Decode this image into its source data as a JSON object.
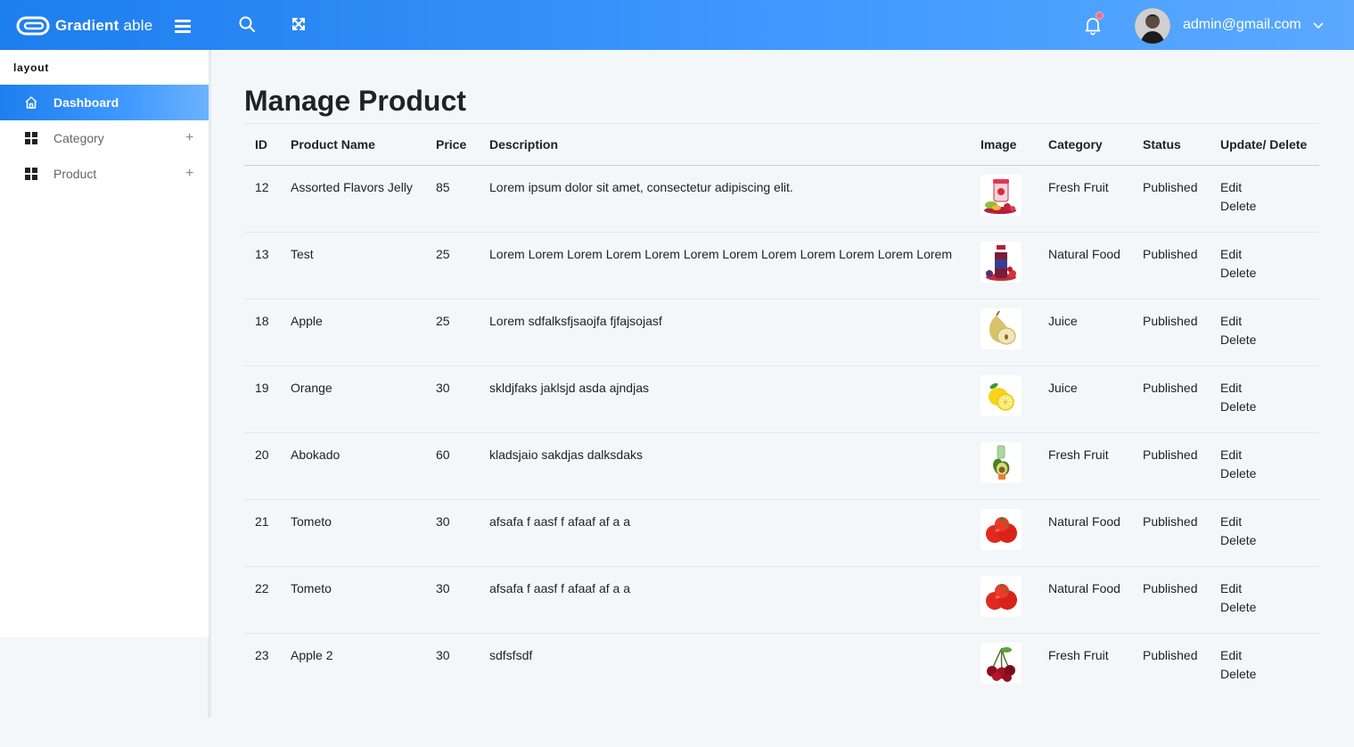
{
  "header": {
    "brand_bold": "Gradient",
    "brand_thin": "able",
    "user_email": "admin@gmail.com",
    "accent": "#4099ff"
  },
  "sidebar": {
    "caption": "layout",
    "items": [
      {
        "label": "Dashboard",
        "icon": "home-icon",
        "active": true
      },
      {
        "label": "Category",
        "icon": "grid-icon",
        "expand": "+"
      },
      {
        "label": "Product",
        "icon": "grid-icon",
        "expand": "+"
      }
    ]
  },
  "main": {
    "title": "Manage Product",
    "columns": [
      "ID",
      "Product Name",
      "Price",
      "Description",
      "Image",
      "Category",
      "Status",
      "Update/ Delete"
    ],
    "edit_label": "Edit",
    "delete_label": "Delete",
    "rows": [
      {
        "id": "12",
        "name": "Assorted Flavors Jelly",
        "price": "85",
        "description": "Lorem ipsum dolor sit amet, consectetur adipiscing elit.",
        "image": "jelly-jar",
        "category": "Fresh Fruit",
        "status": "Published"
      },
      {
        "id": "13",
        "name": "Test",
        "price": "25",
        "description": "Lorem Lorem Lorem Lorem Lorem Lorem Lorem Lorem Lorem Lorem Lorem Lorem",
        "image": "juice-bottle",
        "category": "Natural Food",
        "status": "Published"
      },
      {
        "id": "18",
        "name": "Apple",
        "price": "25",
        "description": "Lorem sdfalksfjsaojfa fjfajsojasf",
        "image": "pear",
        "category": "Juice",
        "status": "Published"
      },
      {
        "id": "19",
        "name": "Orange",
        "price": "30",
        "description": "skldjfaks jaklsjd asda ajndjas",
        "image": "lemon",
        "category": "Juice",
        "status": "Published"
      },
      {
        "id": "20",
        "name": "Abokado",
        "price": "60",
        "description": "kladsjaio sakdjas dalksdaks",
        "image": "avocado",
        "category": "Fresh Fruit",
        "status": "Published"
      },
      {
        "id": "21",
        "name": "Tometo",
        "price": "30",
        "description": "afsafa f aasf f afaaf af a a",
        "image": "tomatoes",
        "category": "Natural Food",
        "status": "Published"
      },
      {
        "id": "22",
        "name": "Tometo",
        "price": "30",
        "description": "afsafa f aasf f afaaf af a a",
        "image": "tomatoes",
        "category": "Natural Food",
        "status": "Published"
      },
      {
        "id": "23",
        "name": "Apple 2",
        "price": "30",
        "description": "sdfsfsdf",
        "image": "cherries",
        "category": "Fresh Fruit",
        "status": "Published"
      }
    ]
  }
}
